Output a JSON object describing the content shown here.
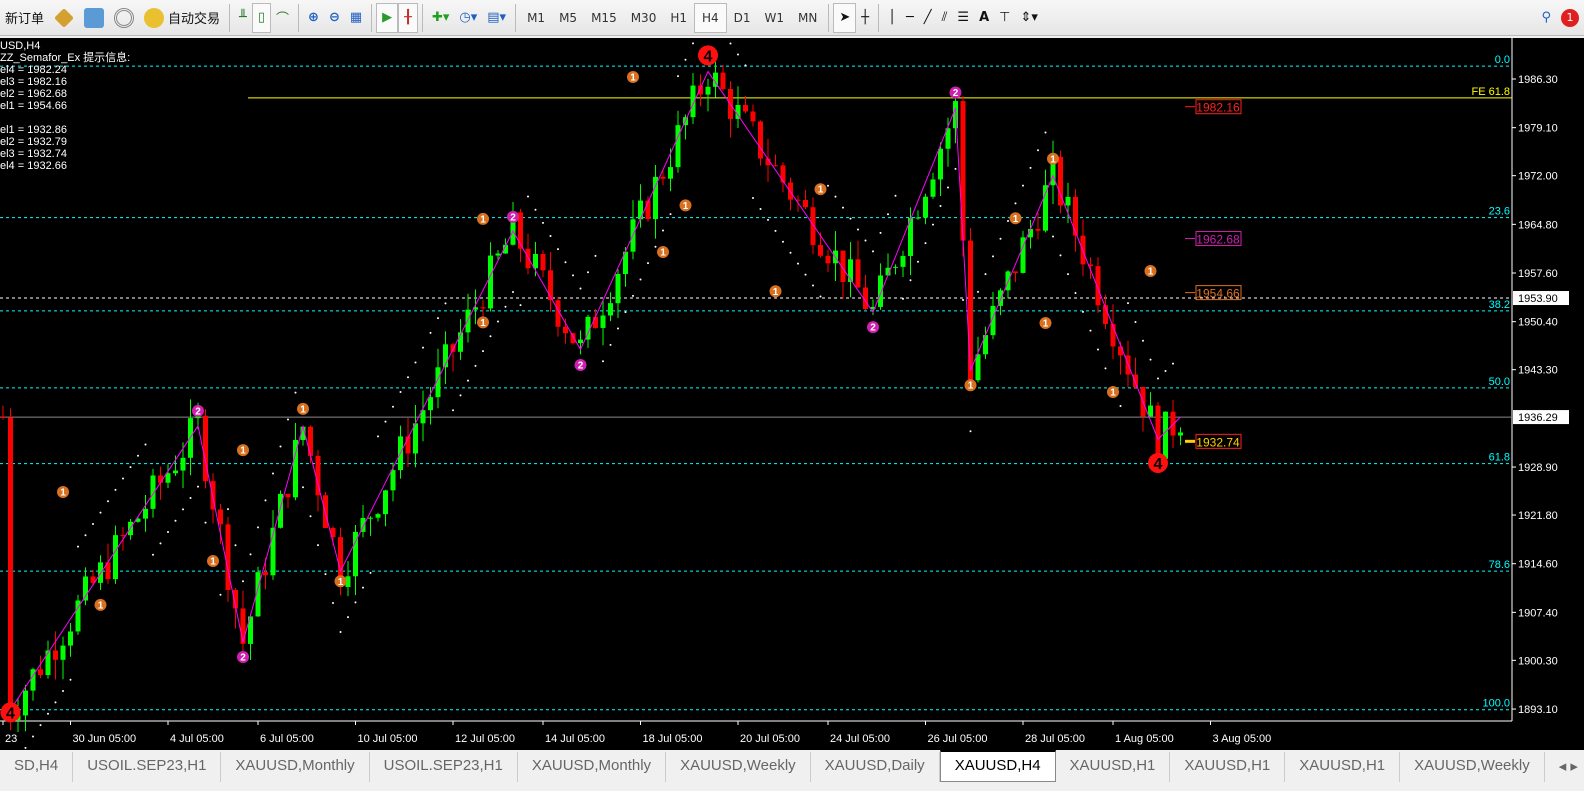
{
  "toolbar": {
    "new_order": "新订单",
    "auto_trading": "自动交易",
    "timeframes": [
      "M1",
      "M5",
      "M15",
      "M30",
      "H1",
      "H4",
      "D1",
      "W1",
      "MN"
    ],
    "active_timeframe": "H4",
    "notification_count": "1"
  },
  "info": {
    "symbol": "USD,H4",
    "indicator": "ZZ_Semafor_Ex 提示信息:",
    "upper": [
      "el4 = 1982.24",
      "el3 = 1982.16",
      "el2 = 1962.68",
      "el1 = 1954.66"
    ],
    "lower": [
      "el1 = 1932.86",
      "el2 = 1932.79",
      "el3 = 1932.74",
      "el4 = 1932.66"
    ]
  },
  "colors": {
    "bull": "#00ff00",
    "bear": "#ff0000",
    "fib": "#00ffff",
    "zigzag": "#ff00ff",
    "fe": "#ffff00"
  },
  "chart_data": {
    "type": "candlestick",
    "symbol": "XAUUSD",
    "timeframe": "H4",
    "ylim": [
      1890.0,
      1993.0
    ],
    "price_ticks": [
      "1986.30",
      "1979.10",
      "1972.00",
      "1964.80",
      "1957.60",
      "1950.40",
      "1943.30",
      "1928.90",
      "1921.80",
      "1914.60",
      "1907.40",
      "1900.30",
      "1893.10"
    ],
    "current_price": "1936.29",
    "marked_price": "1953.90",
    "x_labels": [
      {
        "i": 0,
        "t": "23"
      },
      {
        "i": 9,
        "t": "30 Jun 05:00"
      },
      {
        "i": 22,
        "t": "4 Jul 05:00"
      },
      {
        "i": 34,
        "t": "6 Jul 05:00"
      },
      {
        "i": 47,
        "t": "10 Jul 05:00"
      },
      {
        "i": 60,
        "t": "12 Jul 05:00"
      },
      {
        "i": 72,
        "t": "14 Jul 05:00"
      },
      {
        "i": 85,
        "t": "18 Jul 05:00"
      },
      {
        "i": 98,
        "t": "20 Jul 05:00"
      },
      {
        "i": 110,
        "t": "24 Jul 05:00"
      },
      {
        "i": 123,
        "t": "26 Jul 05:00"
      },
      {
        "i": 136,
        "t": "28 Jul 05:00"
      },
      {
        "i": 148,
        "t": "1 Aug 05:00"
      },
      {
        "i": 161,
        "t": "3 Aug 05:00"
      }
    ],
    "zigzag_pivots": [
      [
        1,
        1893.0
      ],
      [
        26,
        1935.0
      ],
      [
        32,
        1903.0
      ],
      [
        40,
        1934.9
      ],
      [
        45,
        1913.5
      ],
      [
        68,
        1963.8
      ],
      [
        77,
        1946.3
      ],
      [
        94,
        1987.4
      ],
      [
        116,
        1951.8
      ],
      [
        127,
        1982.0
      ],
      [
        129,
        1943.2
      ],
      [
        140,
        1972.0
      ],
      [
        154,
        1933.0
      ],
      [
        157,
        1936.3
      ]
    ],
    "fib_levels": [
      {
        "label": "0.0",
        "price": 1988.2
      },
      {
        "label": "23.6",
        "price": 1965.8
      },
      {
        "label": "38.2",
        "price": 1952.0
      },
      {
        "label": "50.0",
        "price": 1940.6
      },
      {
        "label": "61.8",
        "price": 1929.4
      },
      {
        "label": "78.6",
        "price": 1913.5
      },
      {
        "label": "100.0",
        "price": 1893.0
      }
    ],
    "fe_level": {
      "label": "FE 61.8",
      "price": 1983.5
    },
    "price_labels": [
      {
        "text": "1982.16",
        "price": 1982.2,
        "color": "#ff2020"
      },
      {
        "text": "1962.68",
        "price": 1962.7,
        "color": "#d01fb0"
      },
      {
        "text": "1954.66",
        "price": 1954.7,
        "color": "#e07020"
      },
      {
        "text": "1932.74",
        "price": 1932.7,
        "color": "#ffd000"
      }
    ],
    "semafor": [
      {
        "i": 94,
        "p": 1989.8,
        "n": "4",
        "lvl": 3
      },
      {
        "i": 154,
        "p": 1929.5,
        "n": "4",
        "lvl": 3
      },
      {
        "i": 1,
        "p": 1892.6,
        "n": "4",
        "lvl": 3
      },
      {
        "i": 26,
        "p": 1937.2,
        "n": "2",
        "lvl": 2
      },
      {
        "i": 68,
        "p": 1965.9,
        "n": "2",
        "lvl": 2
      },
      {
        "i": 77,
        "p": 1944.0,
        "n": "2",
        "lvl": 2
      },
      {
        "i": 32,
        "p": 1900.8,
        "n": "2",
        "lvl": 2
      },
      {
        "i": 116,
        "p": 1949.6,
        "n": "2",
        "lvl": 2
      },
      {
        "i": 127,
        "p": 1984.3,
        "n": "2",
        "lvl": 2
      },
      {
        "i": 8,
        "p": 1925.2,
        "n": "1",
        "lvl": 1
      },
      {
        "i": 13,
        "p": 1908.5,
        "n": "1",
        "lvl": 1
      },
      {
        "i": 32,
        "p": 1931.4,
        "n": "1",
        "lvl": 1
      },
      {
        "i": 28,
        "p": 1915.0,
        "n": "1",
        "lvl": 1
      },
      {
        "i": 40,
        "p": 1937.5,
        "n": "1",
        "lvl": 1
      },
      {
        "i": 45,
        "p": 1912.0,
        "n": "1",
        "lvl": 1
      },
      {
        "i": 64,
        "p": 1965.6,
        "n": "1",
        "lvl": 1
      },
      {
        "i": 64,
        "p": 1950.3,
        "n": "1",
        "lvl": 1
      },
      {
        "i": 84,
        "p": 1986.6,
        "n": "1",
        "lvl": 1
      },
      {
        "i": 88,
        "p": 1960.7,
        "n": "1",
        "lvl": 1
      },
      {
        "i": 91,
        "p": 1967.6,
        "n": "1",
        "lvl": 1
      },
      {
        "i": 109,
        "p": 1970.0,
        "n": "1",
        "lvl": 1
      },
      {
        "i": 103,
        "p": 1954.9,
        "n": "1",
        "lvl": 1
      },
      {
        "i": 135,
        "p": 1965.7,
        "n": "1",
        "lvl": 1
      },
      {
        "i": 129,
        "p": 1941.0,
        "n": "1",
        "lvl": 1
      },
      {
        "i": 139,
        "p": 1950.2,
        "n": "1",
        "lvl": 1
      },
      {
        "i": 140,
        "p": 1974.5,
        "n": "1",
        "lvl": 1
      },
      {
        "i": 148,
        "p": 1940.0,
        "n": "1",
        "lvl": 1
      },
      {
        "i": 153,
        "p": 1957.9,
        "n": "1",
        "lvl": 1
      }
    ]
  },
  "tabs": [
    "SD,H4",
    "USOIL.SEP23,H1",
    "XAUUSD,Monthly",
    "USOIL.SEP23,H1",
    "XAUUSD,Monthly",
    "XAUUSD,Weekly",
    "XAUUSD,Daily",
    "XAUUSD,H4",
    "XAUUSD,H1",
    "XAUUSD,H1",
    "XAUUSD,H1",
    "XAUUSD,Weekly"
  ],
  "active_tab": 7
}
